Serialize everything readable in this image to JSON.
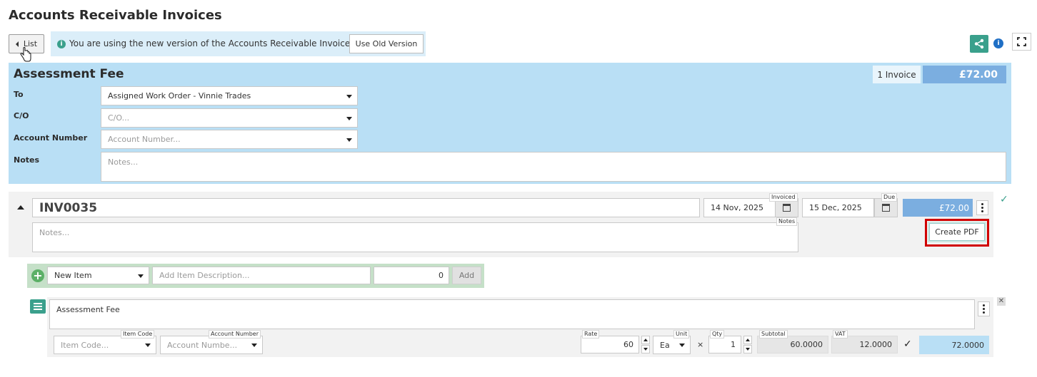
{
  "page": {
    "title": "Accounts Receivable Invoices"
  },
  "toolbar": {
    "list_label": "List"
  },
  "banner": {
    "message": "You are using the new version of the Accounts Receivable Invoices",
    "old_version_label": "Use Old Version"
  },
  "customer": {
    "name": "Assessment Fee",
    "invoice_count": "1 Invoice",
    "total": "£72.00",
    "fields": {
      "to_label": "To",
      "to_value": "Assigned Work Order - Vinnie Trades",
      "co_label": "C/O",
      "co_placeholder": "C/O...",
      "account_label": "Account Number",
      "account_placeholder": "Account Number...",
      "notes_label": "Notes",
      "notes_placeholder": "Notes..."
    }
  },
  "invoice": {
    "number": "INV0035",
    "invoiced_label": "Invoiced",
    "invoiced_date": "14 Nov, 2025",
    "due_label": "Due",
    "due_date": "15 Dec, 2025",
    "amount": "£72.00",
    "notes_placeholder": "Notes...",
    "notes_label": "Notes",
    "create_pdf_label": "Create PDF"
  },
  "add_item": {
    "type_value": "New Item",
    "description_placeholder": "Add Item Description...",
    "amount_value": "0",
    "add_label": "Add"
  },
  "line_item": {
    "description": "Assessment Fee",
    "item_code_label": "Item Code",
    "item_code_placeholder": "Item Code...",
    "account_number_label": "Account Number",
    "account_number_placeholder": "Account Numbe...",
    "rate_label": "Rate",
    "rate_value": "60",
    "unit_label": "Unit",
    "unit_value": "Ea",
    "times": "×",
    "qty_label": "Qty",
    "qty_value": "1",
    "subtotal_label": "Subtotal",
    "subtotal_value": "60.0000",
    "vat_label": "VAT",
    "vat_value": "12.0000",
    "total_value": "72.0000"
  },
  "colors": {
    "header_blue": "#b9dff5",
    "amount_blue": "#7baee0",
    "accent_teal": "#3aa08c",
    "highlight_red": "#d00000"
  }
}
